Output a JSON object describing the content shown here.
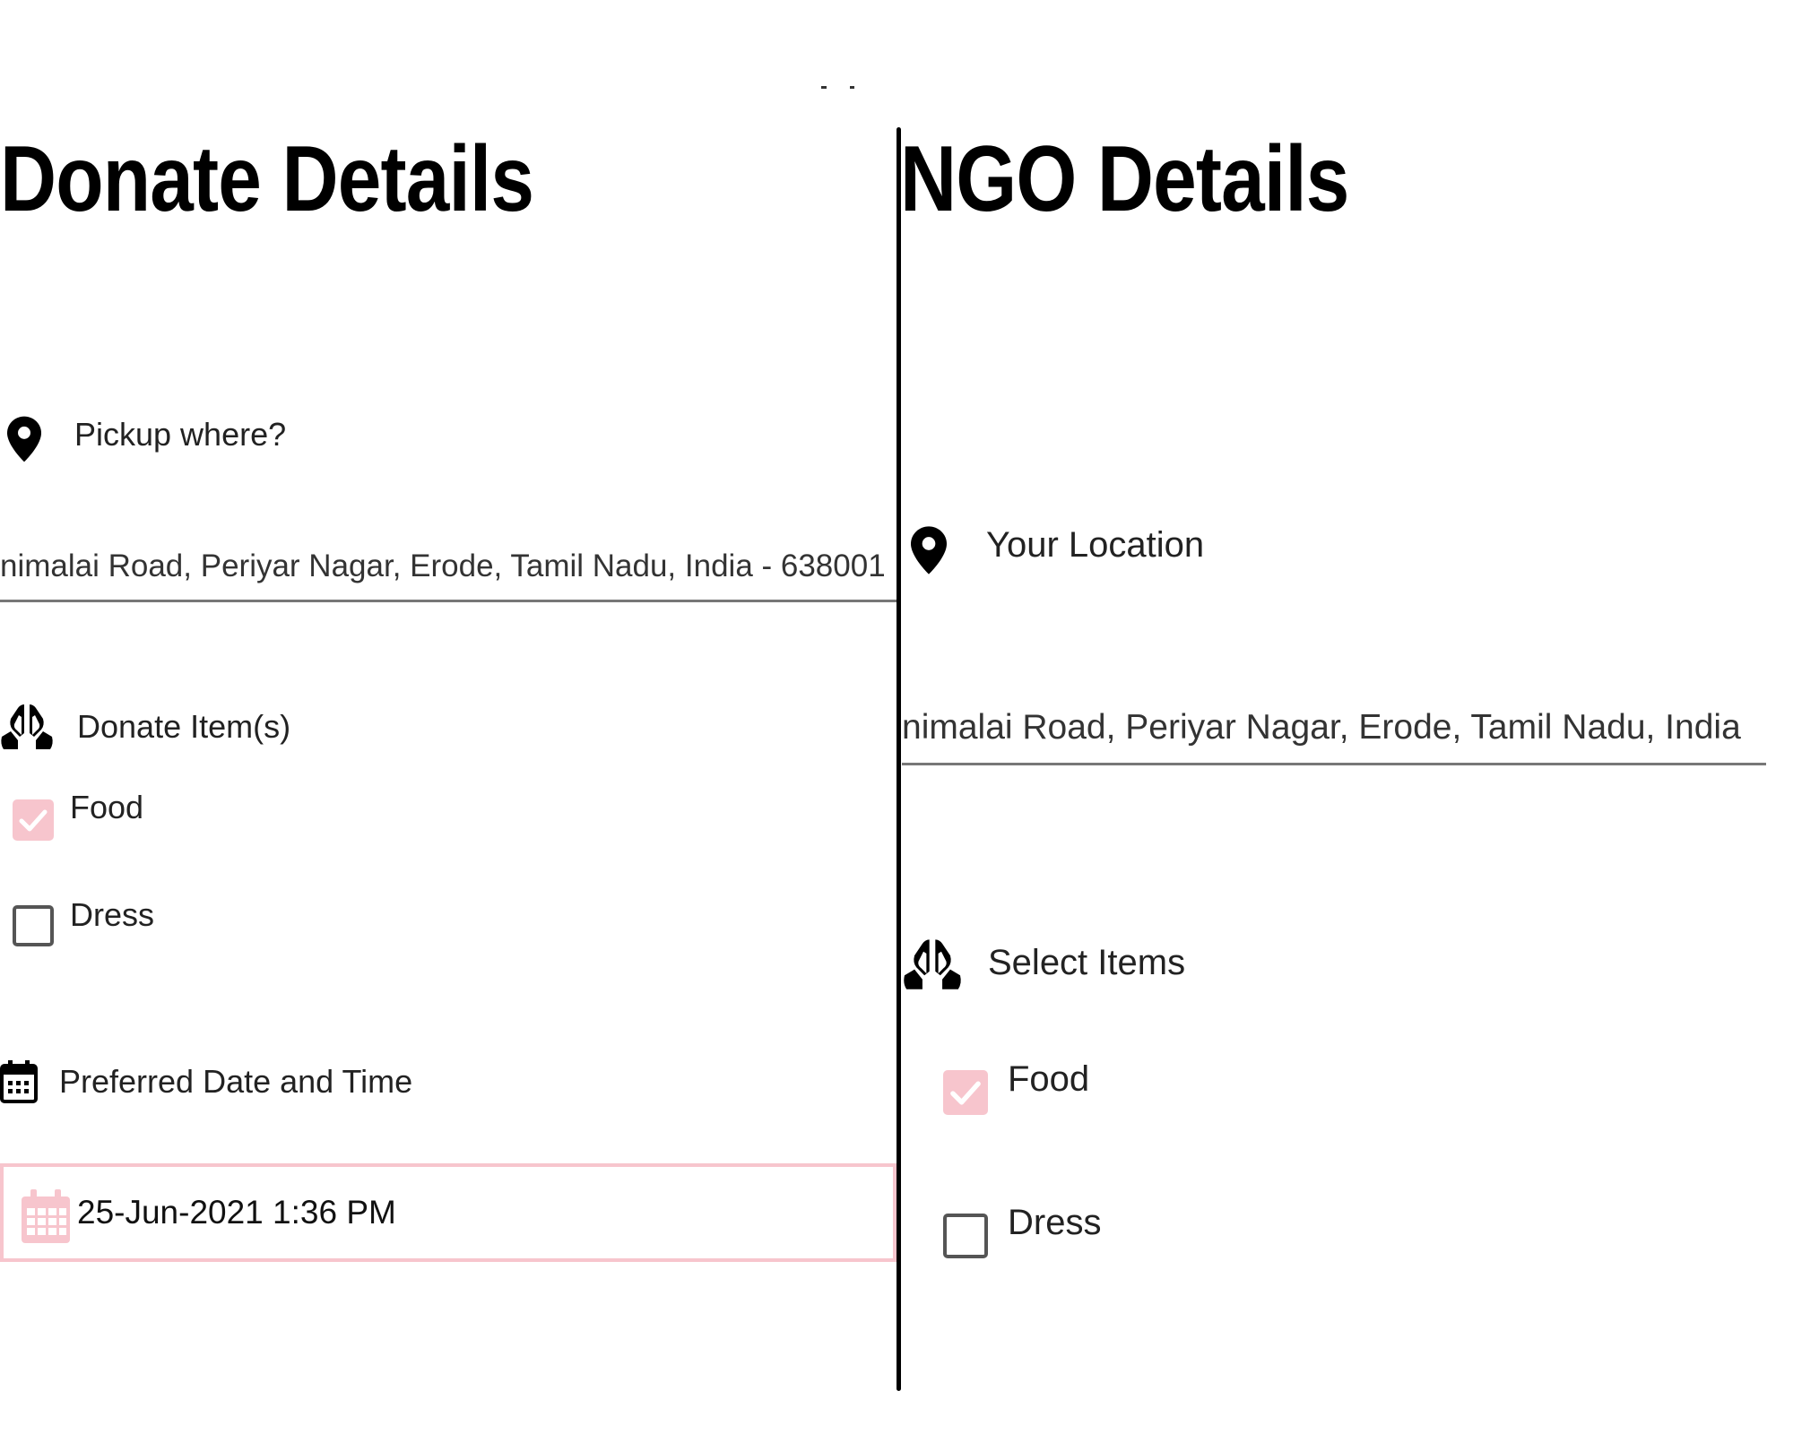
{
  "donate": {
    "title": "Donate Details",
    "pickup": {
      "label": "Pickup where?",
      "value": "nimalai Road, Periyar Nagar, Erode, Tamil Nadu, India - 638001"
    },
    "items": {
      "label": "Donate Item(s)",
      "options": [
        {
          "label": "Food",
          "checked": true
        },
        {
          "label": "Dress",
          "checked": false
        }
      ]
    },
    "datetime": {
      "label": "Preferred Date and Time",
      "value": "25-Jun-2021 1:36 PM"
    }
  },
  "ngo": {
    "title": "NGO Details",
    "location": {
      "label": "Your Location",
      "value": "nimalai Road, Periyar Nagar, Erode, Tamil Nadu, India"
    },
    "items": {
      "label": "Select Items",
      "options": [
        {
          "label": "Food",
          "checked": true
        },
        {
          "label": "Dress",
          "checked": false
        }
      ]
    }
  },
  "colors": {
    "accent_pink": "#f7c5cd",
    "divider": "#000000",
    "text": "#222222"
  },
  "icons": {
    "location": "map-pin-icon",
    "items": "praying-hands-icon",
    "calendar": "calendar-icon"
  }
}
